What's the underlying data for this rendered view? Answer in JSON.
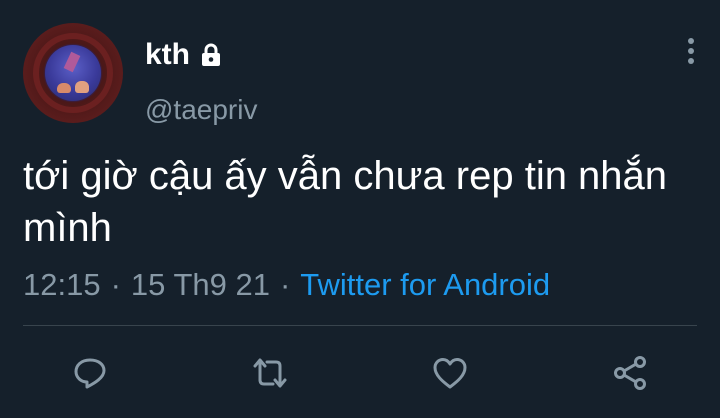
{
  "tweet": {
    "author_name": "kth",
    "author_handle": "@taepriv",
    "text": "tới giờ cậu ấy vẫn chưa rep tin nhắn mình",
    "time": "12:15",
    "date": "15 Th9 21",
    "separator": "·",
    "source": "Twitter for Android",
    "protected_icon": "lock-icon"
  },
  "actions": {
    "reply_icon": "reply-icon",
    "retweet_icon": "retweet-icon",
    "like_icon": "heart-icon",
    "share_icon": "share-icon",
    "more_icon": "more-vertical-icon"
  },
  "colors": {
    "background": "#15202b",
    "primary_text": "#ffffff",
    "secondary_text": "#8899a6",
    "link": "#1d9bf0",
    "divider": "#38444d"
  }
}
